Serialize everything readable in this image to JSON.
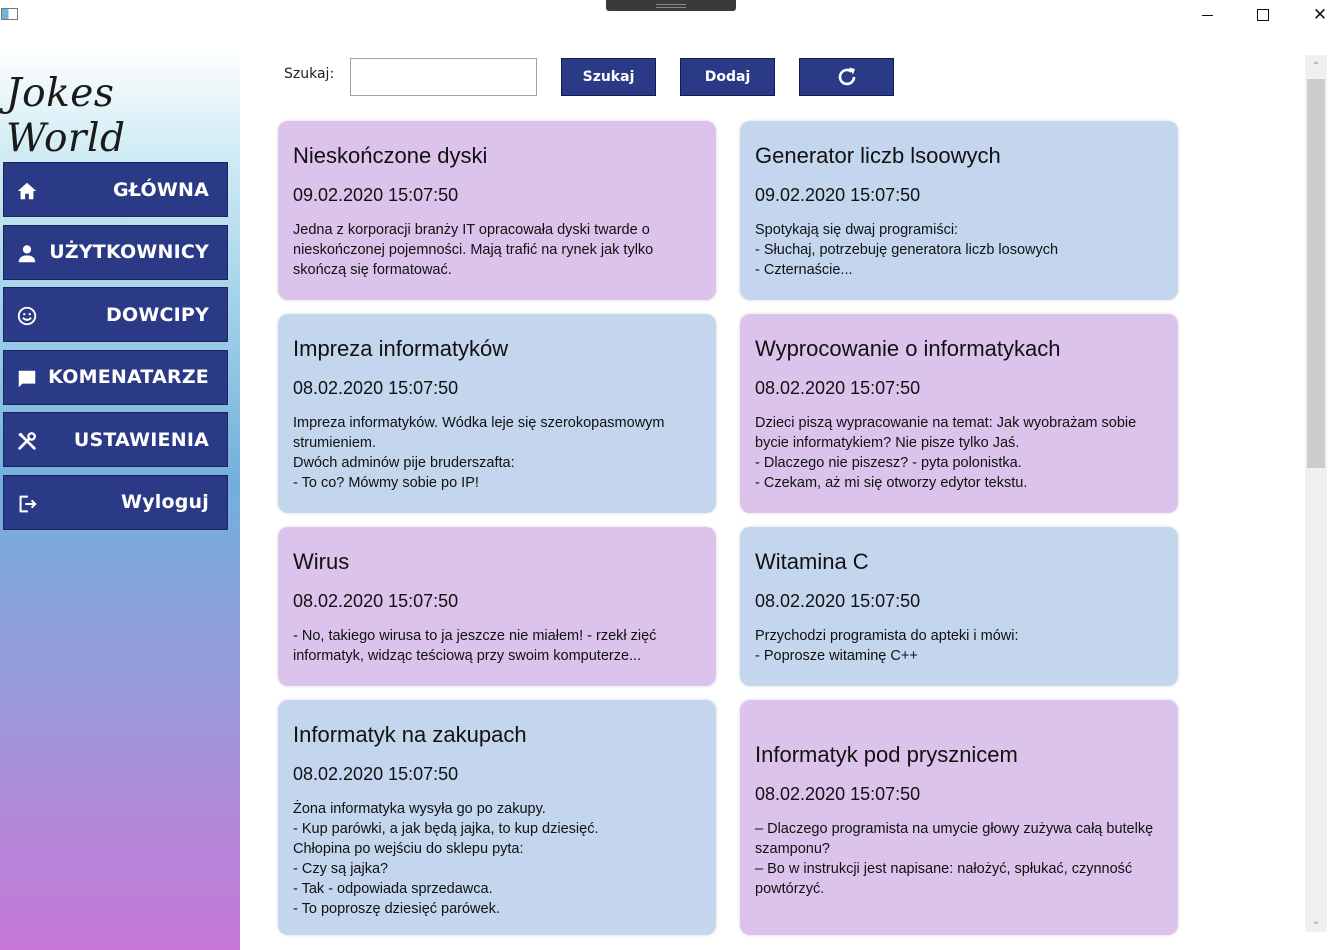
{
  "window": {
    "minimize_glyph": "",
    "close_glyph": "✕"
  },
  "sidebar": {
    "logo": "Jokes World",
    "items": [
      {
        "label": "GŁÓWNA",
        "icon": "home-icon"
      },
      {
        "label": "UŻYTKOWNICY",
        "icon": "user-icon"
      },
      {
        "label": "DOWCIPY",
        "icon": "smiley-icon"
      },
      {
        "label": "KOMENATARZE",
        "icon": "comment-icon"
      },
      {
        "label": "USTAWIENIA",
        "icon": "tools-icon"
      },
      {
        "label": "Wyloguj",
        "icon": "logout-icon"
      }
    ]
  },
  "toolbar": {
    "search_label": "Szukaj:",
    "search_value": "",
    "search_button": "Szukaj",
    "add_button": "Dodaj",
    "refresh_icon": "refresh-icon"
  },
  "colors": {
    "accent": "#2b3a86",
    "card_purple": "#dcc3ec",
    "card_blue": "#c4d6ee"
  },
  "jokes": [
    {
      "title": "Nieskończone dyski",
      "date": "09.02.2020 15:07:50",
      "lines": [
        "Jedna z korporacji branży IT opracowała dyski twarde o",
        "nieskończonej pojemności. Mają trafić na rynek jak tylko",
        "skończą się formatować."
      ]
    },
    {
      "title": "Generator liczb lsoowych",
      "date": "09.02.2020 15:07:50",
      "lines": [
        "Spotykają się dwaj programiści:",
        "- Słuchaj, potrzebuję generatora liczb losowych",
        "- Czternaście..."
      ]
    },
    {
      "title": "Impreza informatyków",
      "date": "08.02.2020 15:07:50",
      "lines": [
        "Impreza informatyków. Wódka leje się szerokopasmowym",
        "strumieniem.",
        "Dwóch adminów pije bruderszafta:",
        "- To co? Mówmy sobie po IP!"
      ]
    },
    {
      "title": "Wyprocowanie o informatykach",
      "date": "08.02.2020 15:07:50",
      "lines": [
        "Dzieci piszą wypracowanie na temat: Jak wyobrażam sobie",
        "bycie informatykiem? Nie pisze tylko Jaś.",
        "- Dlaczego nie piszesz? - pyta polonistka.",
        "- Czekam, aż mi się otworzy edytor tekstu."
      ]
    },
    {
      "title": "Wirus",
      "date": "08.02.2020 15:07:50",
      "lines": [
        "- No, takiego wirusa to ja jeszcze nie miałem! - rzekł zięć",
        "informatyk, widząc teściową przy swoim komputerze..."
      ]
    },
    {
      "title": "Witamina C",
      "date": "08.02.2020 15:07:50",
      "lines": [
        "Przychodzi programista do apteki i mówi:",
        "- Poprosze witaminę C++"
      ]
    },
    {
      "title": "Informatyk na zakupach",
      "date": "08.02.2020 15:07:50",
      "lines": [
        "Żona informatyka wysyła go po zakupy.",
        "- Kup parówki, a jak będą jajka, to kup dziesięć.",
        "Chłopina po wejściu do sklepu pyta:",
        "- Czy są jajka?",
        "- Tak - odpowiada sprzedawca.",
        "- To poproszę dziesięć parówek."
      ]
    },
    {
      "title": "Informatyk pod prysznicem",
      "date": "08.02.2020 15:07:50",
      "lines": [
        "– Dlaczego programista na umycie głowy zużywa całą butelkę",
        "szamponu?",
        "– Bo w instrukcji jest napisane: nałożyć, spłukać, czynność",
        "powtórzyć."
      ]
    }
  ],
  "scrollbar": {
    "up_glyph": "⌃",
    "down_glyph": "⌄"
  }
}
